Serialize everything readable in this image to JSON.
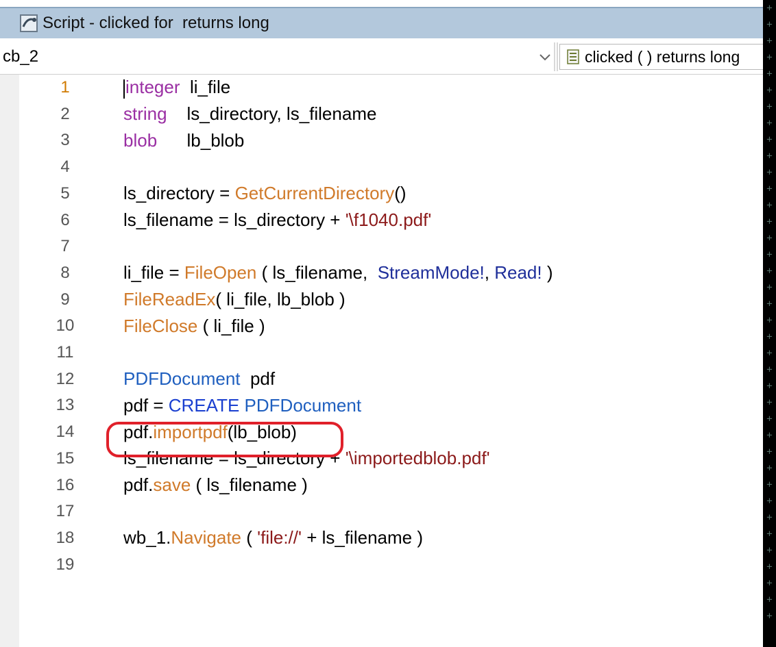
{
  "window": {
    "title": "Script - clicked for  returns long",
    "title_icon": "script-icon"
  },
  "toolbar": {
    "object_value": "cb_2",
    "event_value": "clicked ( )  returns long",
    "event_icon": "event-list-icon",
    "dropdown_icon": "chevron-down-icon"
  },
  "editor": {
    "current_line": 1,
    "lines": [
      {
        "num": "1",
        "parts": [
          {
            "t": "integer",
            "c": "kw-type"
          },
          {
            "t": "  li_file"
          }
        ]
      },
      {
        "num": "2",
        "parts": [
          {
            "t": "string",
            "c": "kw-type"
          },
          {
            "t": "    ls_directory, ls_filename"
          }
        ]
      },
      {
        "num": "3",
        "parts": [
          {
            "t": "blob",
            "c": "kw-type"
          },
          {
            "t": "      lb_blob"
          }
        ]
      },
      {
        "num": "4",
        "parts": []
      },
      {
        "num": "5",
        "parts": [
          {
            "t": "ls_directory = "
          },
          {
            "t": "GetCurrentDirectory",
            "c": "fn"
          },
          {
            "t": "()"
          }
        ]
      },
      {
        "num": "6",
        "parts": [
          {
            "t": "ls_filename = ls_directory + "
          },
          {
            "t": "'\\f1040.pdf'",
            "c": "str"
          }
        ]
      },
      {
        "num": "7",
        "parts": []
      },
      {
        "num": "8",
        "parts": [
          {
            "t": "li_file = "
          },
          {
            "t": "FileOpen",
            "c": "fn"
          },
          {
            "t": " ( ls_filename,  "
          },
          {
            "t": "StreamMode!",
            "c": "enum"
          },
          {
            "t": ", "
          },
          {
            "t": "Read!",
            "c": "enum"
          },
          {
            "t": " )"
          }
        ]
      },
      {
        "num": "9",
        "parts": [
          {
            "t": "FileReadEx",
            "c": "fn"
          },
          {
            "t": "( li_file, lb_blob )"
          }
        ]
      },
      {
        "num": "10",
        "parts": [
          {
            "t": "FileClose",
            "c": "fn"
          },
          {
            "t": " ( li_file )"
          }
        ]
      },
      {
        "num": "11",
        "parts": []
      },
      {
        "num": "12",
        "parts": [
          {
            "t": "PDFDocument",
            "c": "cls"
          },
          {
            "t": "  pdf"
          }
        ]
      },
      {
        "num": "13",
        "parts": [
          {
            "t": "pdf = "
          },
          {
            "t": "CREATE",
            "c": "create"
          },
          {
            "t": " "
          },
          {
            "t": "PDFDocument",
            "c": "cls"
          }
        ]
      },
      {
        "num": "14",
        "parts": [
          {
            "t": "pdf."
          },
          {
            "t": "importpdf",
            "c": "fn"
          },
          {
            "t": "(lb_blob)"
          }
        ]
      },
      {
        "num": "15",
        "parts": [
          {
            "t": "ls_filename = ls_directory + "
          },
          {
            "t": "'\\importedblob.pdf'",
            "c": "str"
          }
        ]
      },
      {
        "num": "16",
        "parts": [
          {
            "t": "pdf."
          },
          {
            "t": "save",
            "c": "fn"
          },
          {
            "t": " ( ls_filename )"
          }
        ]
      },
      {
        "num": "17",
        "parts": []
      },
      {
        "num": "18",
        "parts": [
          {
            "t": "wb_1."
          },
          {
            "t": "Navigate",
            "c": "fn"
          },
          {
            "t": " ( "
          },
          {
            "t": "'file://'",
            "c": "str"
          },
          {
            "t": " + ls_filename )"
          }
        ]
      },
      {
        "num": "19",
        "parts": []
      }
    ]
  },
  "annotation": {
    "highlighted_line": 14,
    "color": "#e0202a"
  },
  "colors": {
    "titlebar": "#b3c8dc",
    "type_keyword": "#9a2fa3",
    "function": "#d07a2a",
    "string": "#8c1a1a",
    "enum": "#1f2f9a",
    "class": "#1f5fbf"
  }
}
